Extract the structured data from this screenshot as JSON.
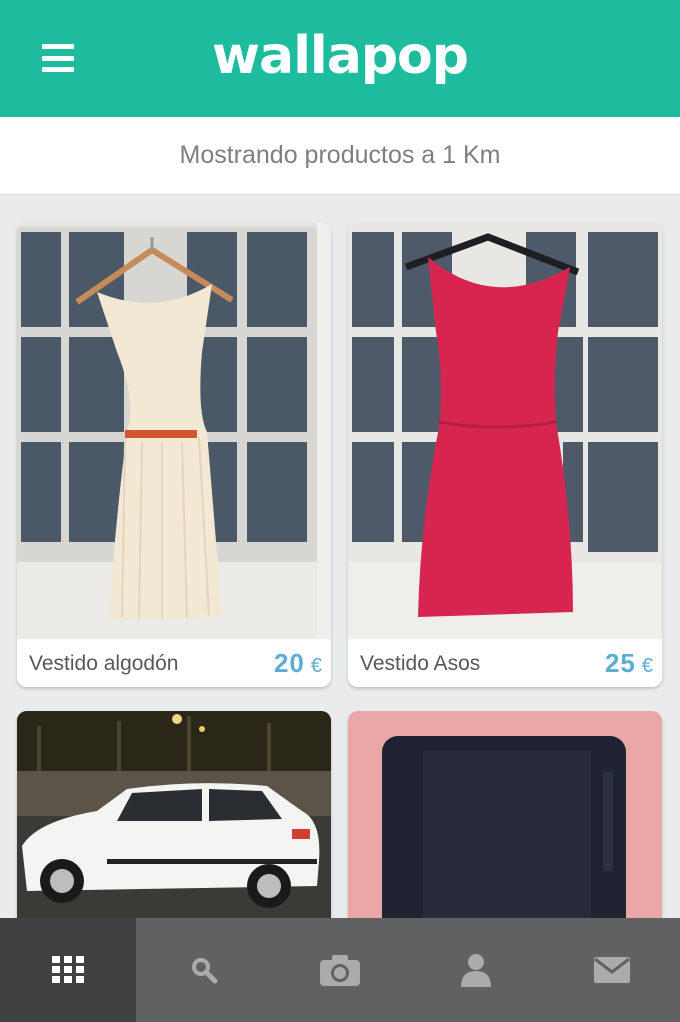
{
  "app": {
    "brand": "wallapop",
    "accent": "#1ebc9f",
    "price_color": "#5aaed3"
  },
  "header": {
    "menu_icon": "hamburger-menu-icon",
    "logo_text": "wallapop"
  },
  "location_bar": {
    "text": "Mostrando productos a 1 Km"
  },
  "products": [
    {
      "title": "Vestido algodón",
      "price": "20",
      "currency": "€",
      "image": "cream-dress-photo"
    },
    {
      "title": "Vestido Asos",
      "price": "25",
      "currency": "€",
      "image": "pink-dress-photo"
    },
    {
      "title": "",
      "price": "",
      "currency": "",
      "image": "white-car-photo"
    },
    {
      "title": "",
      "price": "",
      "currency": "",
      "image": "ereader-photo"
    }
  ],
  "tabbar": {
    "items": [
      {
        "icon": "grid-icon",
        "active": true
      },
      {
        "icon": "search-icon",
        "active": false
      },
      {
        "icon": "camera-icon",
        "active": false
      },
      {
        "icon": "user-icon",
        "active": false
      },
      {
        "icon": "mail-icon",
        "active": false
      }
    ]
  }
}
